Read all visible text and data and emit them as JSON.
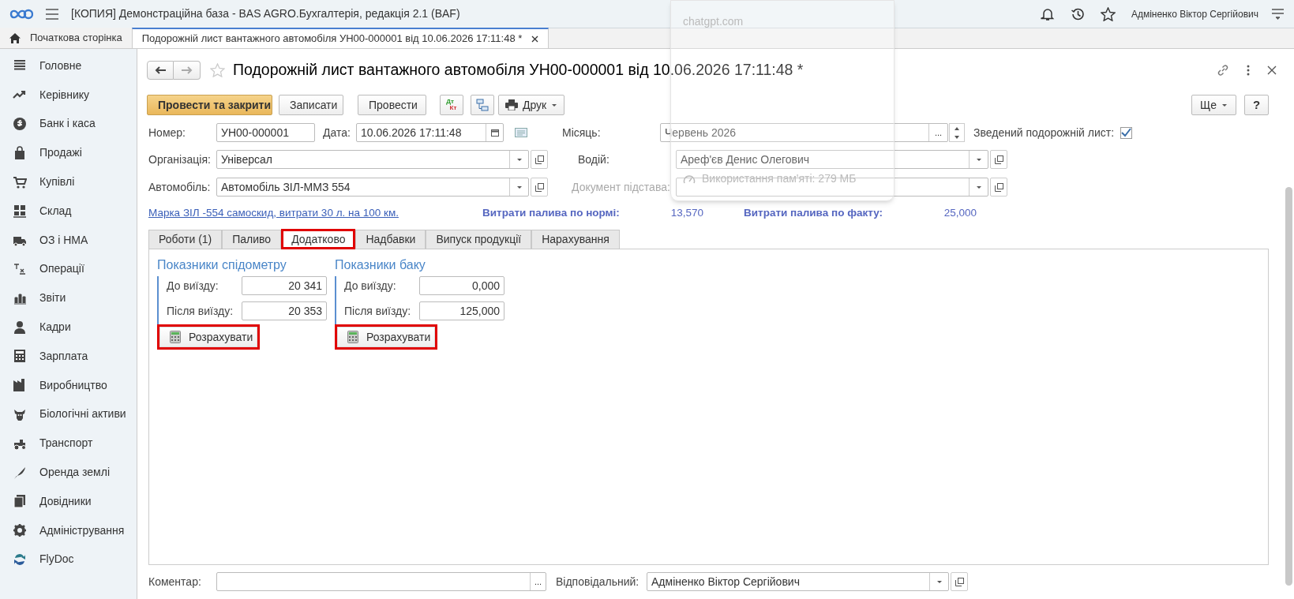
{
  "app": {
    "title": "[КОПИЯ] Демонстраційна база - BAS AGRO.Бухгалтерія, редакція 2.1  (BAF)",
    "user": "Адміненко Віктор Сергійович"
  },
  "overlay": {
    "site": "chatgpt.com",
    "memory": "Використання пам'яті: 279 МБ"
  },
  "open_tabs": [
    {
      "label": "Початкова сторінка",
      "kind": "home",
      "selected": false
    },
    {
      "label": "Подорожній лист вантажного автомобіля УН00-000001 від 10.06.2026 17:11:48 *",
      "kind": "document",
      "selected": true
    }
  ],
  "sidebar": {
    "items": [
      {
        "label": "Головне"
      },
      {
        "label": "Керівнику"
      },
      {
        "label": "Банк і каса"
      },
      {
        "label": "Продажі"
      },
      {
        "label": "Купівлі"
      },
      {
        "label": "Склад"
      },
      {
        "label": "ОЗ і НМА"
      },
      {
        "label": "Операції"
      },
      {
        "label": "Звіти"
      },
      {
        "label": "Кадри"
      },
      {
        "label": "Зарплата"
      },
      {
        "label": "Виробництво"
      },
      {
        "label": "Біологічні активи"
      },
      {
        "label": "Транспорт"
      },
      {
        "label": "Оренда землі"
      },
      {
        "label": "Довідники"
      },
      {
        "label": "Адміністрування"
      },
      {
        "label": "FlyDoc"
      }
    ]
  },
  "document": {
    "title": "Подорожній лист вантажного автомобіля УН00-000001 від 10.06.2026 17:11:48 *",
    "buttons": [
      {
        "label": "Провести та закрити",
        "kind": "primary"
      },
      {
        "label": "Записати",
        "kind": "default"
      },
      {
        "label": "Провести",
        "kind": "default"
      }
    ],
    "dt_kt": [
      "Дт",
      "Кт"
    ],
    "print_button": "Друк",
    "more_button": "Ще",
    "help_button": "?",
    "number": {
      "label": "Номер:",
      "value": "УН00-000001"
    },
    "date": {
      "label": "Дата:",
      "value": "10.06.2026 17:11:48"
    },
    "month": {
      "label": "Місяць:",
      "value": "Червень 2026",
      "select_button": "..."
    },
    "summary": {
      "label": "Зведений подорожній лист:",
      "checked": true
    },
    "organization": {
      "label": "Організація:",
      "value": "Універсал"
    },
    "driver": {
      "label": "Водій:",
      "value": "Ареф'єв Денис Олегович"
    },
    "vehicle": {
      "label": "Автомобіль:",
      "value": "Автомобіль ЗІЛ-ММЗ  554"
    },
    "basis": {
      "label": "Документ підстава:",
      "disabled": true
    },
    "vehicle_link": "Марка ЗІЛ -554 самоскид, витрати 30 л. на 100 км.",
    "fuel_norm": {
      "label": "Витрати палива по нормі:",
      "value": "13,570"
    },
    "fuel_fact": {
      "label": "Витрати палива по факту:",
      "value": "25,000"
    },
    "tabs": [
      {
        "label": "Роботи (1)",
        "selected": false,
        "highlighted": false
      },
      {
        "label": "Паливо",
        "selected": false,
        "highlighted": false
      },
      {
        "label": "Додатково",
        "selected": true,
        "highlighted": true
      },
      {
        "label": "Надбавки",
        "selected": false,
        "highlighted": false
      },
      {
        "label": "Випуск продукції",
        "selected": false,
        "highlighted": false
      },
      {
        "label": "Нарахування",
        "selected": false,
        "highlighted": false
      }
    ],
    "groups": [
      {
        "title": "Показники спідометру",
        "rows": [
          {
            "label": "До виїзду:",
            "value": "20 341"
          },
          {
            "label": "Після виїзду:",
            "value": "20 353"
          }
        ],
        "button": "Розрахувати",
        "highlighted": true
      },
      {
        "title": "Показники баку",
        "rows": [
          {
            "label": "До виїзду:",
            "value": "0,000"
          },
          {
            "label": "Після виїзду:",
            "value": "125,000"
          }
        ],
        "button": "Розрахувати",
        "highlighted": true
      }
    ],
    "comment": {
      "label": "Коментар:",
      "select_button": "..."
    },
    "responsible": {
      "label": "Відповідальний:",
      "value": "Адміненко Віктор Сергійович"
    }
  }
}
